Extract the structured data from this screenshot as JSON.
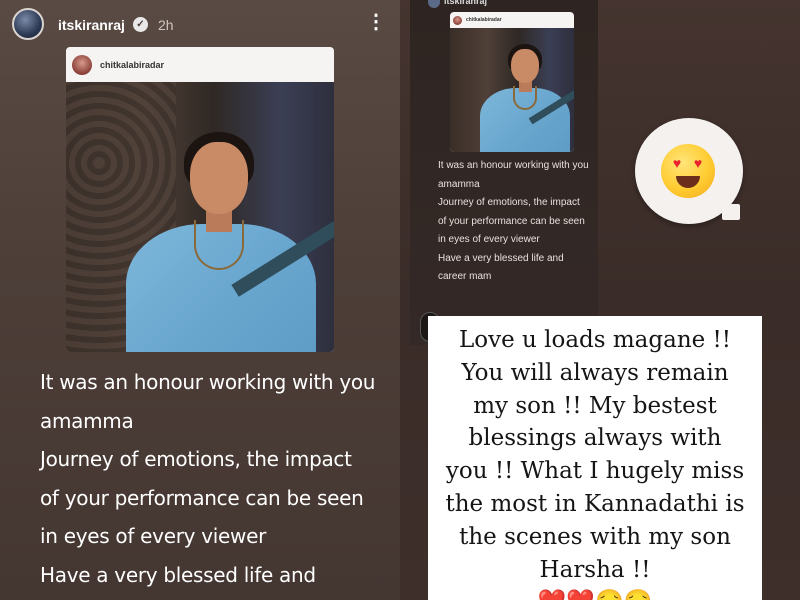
{
  "left_story": {
    "username": "itskiranraj",
    "time": "2h",
    "verified_glyph": "✓",
    "more_glyph": "⋮",
    "post": {
      "handle": "chitkalabiradar"
    },
    "caption_lines": [
      "It was an honour working with you",
      "amamma",
      "Journey of emotions, the impact",
      "of your performance can be seen",
      "in eyes of every viewer",
      "Have a very blessed life and"
    ]
  },
  "right_story": {
    "username": "itskiranraj",
    "post": {
      "handle": "chitkalabiradar"
    },
    "caption_lines": [
      "It was an honour working with you",
      "amamma",
      "Journey of emotions, the impact",
      "of your performance can be seen",
      "in eyes of every viewer",
      "Have a very blessed life and",
      "career mam"
    ],
    "reaction_emoji": "heart-eyes",
    "message_lines": [
      "Love u loads magane !!",
      "You will always remain",
      "my son  !! My bestest",
      "blessings always with",
      "you !! What I hugely miss",
      "the most in Kannadathi is",
      "the scenes with my son"
    ],
    "message_last_line_text": "Harsha !! ",
    "message_last_line_emojis": "❤️❤️😔😔"
  },
  "colors": {
    "background_left": "#4d3e38",
    "background_right": "#3a2c28",
    "text_white": "#ffffff",
    "heart_red": "#e2192c"
  }
}
